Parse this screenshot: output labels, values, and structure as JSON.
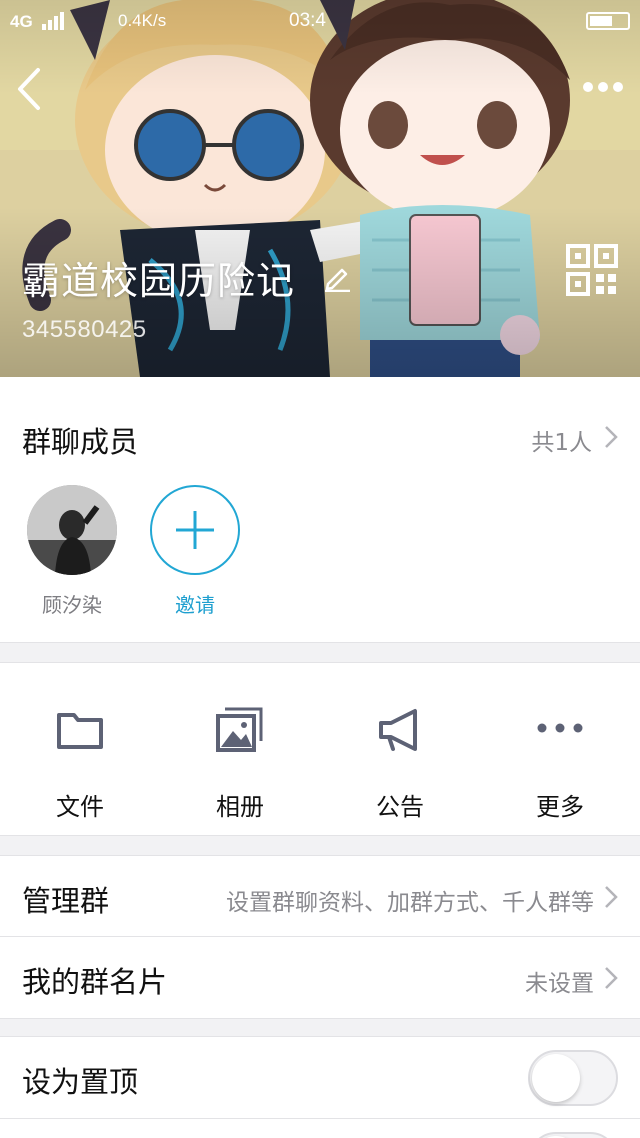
{
  "status_bar": {
    "network": "4G",
    "speed": "0.4K/s",
    "time": "03:4"
  },
  "header": {
    "back_icon": "chevron-left-icon",
    "more_icon": "more-horizontal-icon",
    "group_name": "霸道校园历险记",
    "edit_icon": "pencil-icon",
    "group_id": "345580425",
    "qr_icon": "qr-code-icon",
    "banner_colors": {
      "background": "#e3d8a4",
      "shirt": "#9fd8dc",
      "pants": "#2f4f86",
      "vest": "#1d2634"
    }
  },
  "members": {
    "title": "群聊成员",
    "count": "共1人",
    "list": [
      {
        "name": "顾汐染"
      }
    ],
    "invite_label": "邀请",
    "accent_color": "#22a7d4"
  },
  "actions": [
    {
      "label": "文件",
      "icon": "folder-icon"
    },
    {
      "label": "相册",
      "icon": "album-icon"
    },
    {
      "label": "公告",
      "icon": "megaphone-icon"
    },
    {
      "label": "更多",
      "icon": "more-dots-icon"
    }
  ],
  "rows": {
    "manage": {
      "title": "管理群",
      "value": "设置群聊资料、加群方式、千人群等"
    },
    "card": {
      "title": "我的群名片",
      "value": "未设置"
    },
    "pin": {
      "title": "设为置顶",
      "enabled": false
    }
  }
}
